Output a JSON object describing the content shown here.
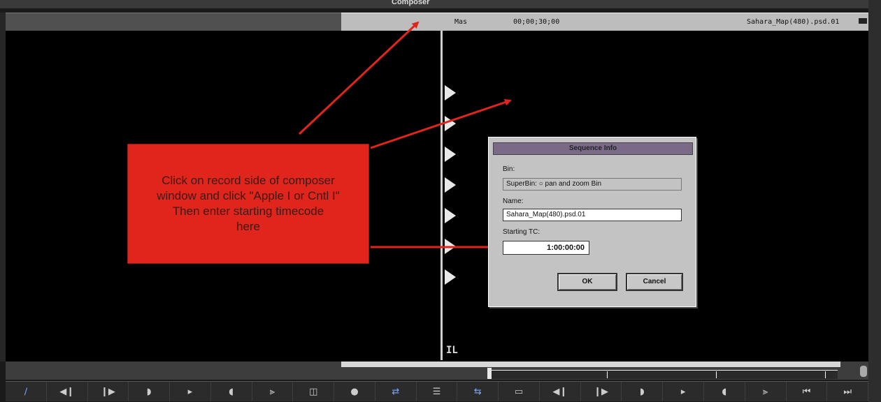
{
  "window": {
    "title": "Composer"
  },
  "info_bar": {
    "display_label": "Mas",
    "timecode": "00;00;30;00",
    "clip_name": "Sahara_Map(480).psd.01"
  },
  "annotation": {
    "text": "Click on record side of composer\nwindow and click \"Apple I or Cntl I\"\nThen enter starting timecode\nhere"
  },
  "dialog": {
    "title": "Sequence Info",
    "bin_label": "Bin:",
    "bin_value": "SuperBin: ○ pan and zoom Bin",
    "name_label": "Name:",
    "name_value": "Sahara_Map(480).psd.01",
    "tc_label": "Starting TC:",
    "tc_value": "1:00:00:00",
    "ok_label": "OK",
    "cancel_label": "Cancel"
  },
  "viewer": {
    "track_marker": "IL"
  },
  "buttons": [
    {
      "name": "pen-icon",
      "glyph": "∕"
    },
    {
      "name": "step-back-icon",
      "glyph": "◀❙"
    },
    {
      "name": "step-forward-icon",
      "glyph": "❙▶"
    },
    {
      "name": "play-reverse-icon",
      "glyph": "◗"
    },
    {
      "name": "play-icon",
      "glyph": "▸"
    },
    {
      "name": "mark-in-icon",
      "glyph": "◖"
    },
    {
      "name": "mark-clip-icon",
      "glyph": "⫸"
    },
    {
      "name": "clear-marks-icon",
      "glyph": "◫"
    },
    {
      "name": "record-icon",
      "glyph": "●"
    },
    {
      "name": "splice-icon",
      "glyph": "⇄"
    },
    {
      "name": "overwrite-icon",
      "glyph": "☰"
    },
    {
      "name": "lift-icon",
      "glyph": "⇆"
    },
    {
      "name": "subclip-icon",
      "glyph": "▭"
    },
    {
      "name": "step-back-record-icon",
      "glyph": "◀❙"
    },
    {
      "name": "step-forward-record-icon",
      "glyph": "❙▶"
    },
    {
      "name": "play-reverse-record-icon",
      "glyph": "◗"
    },
    {
      "name": "play-record-icon",
      "glyph": "▸"
    },
    {
      "name": "mark-in-record-icon",
      "glyph": "◖"
    },
    {
      "name": "mark-clip-record-icon",
      "glyph": "⫸"
    },
    {
      "name": "go-to-in-icon",
      "glyph": "⏮"
    },
    {
      "name": "go-to-out-icon",
      "glyph": "⏭"
    }
  ],
  "colors": {
    "annotation": "#e0251c",
    "dialog_title": "#7a6a88",
    "viewer": "#000000",
    "accent_icons": "#7ea7ff"
  }
}
